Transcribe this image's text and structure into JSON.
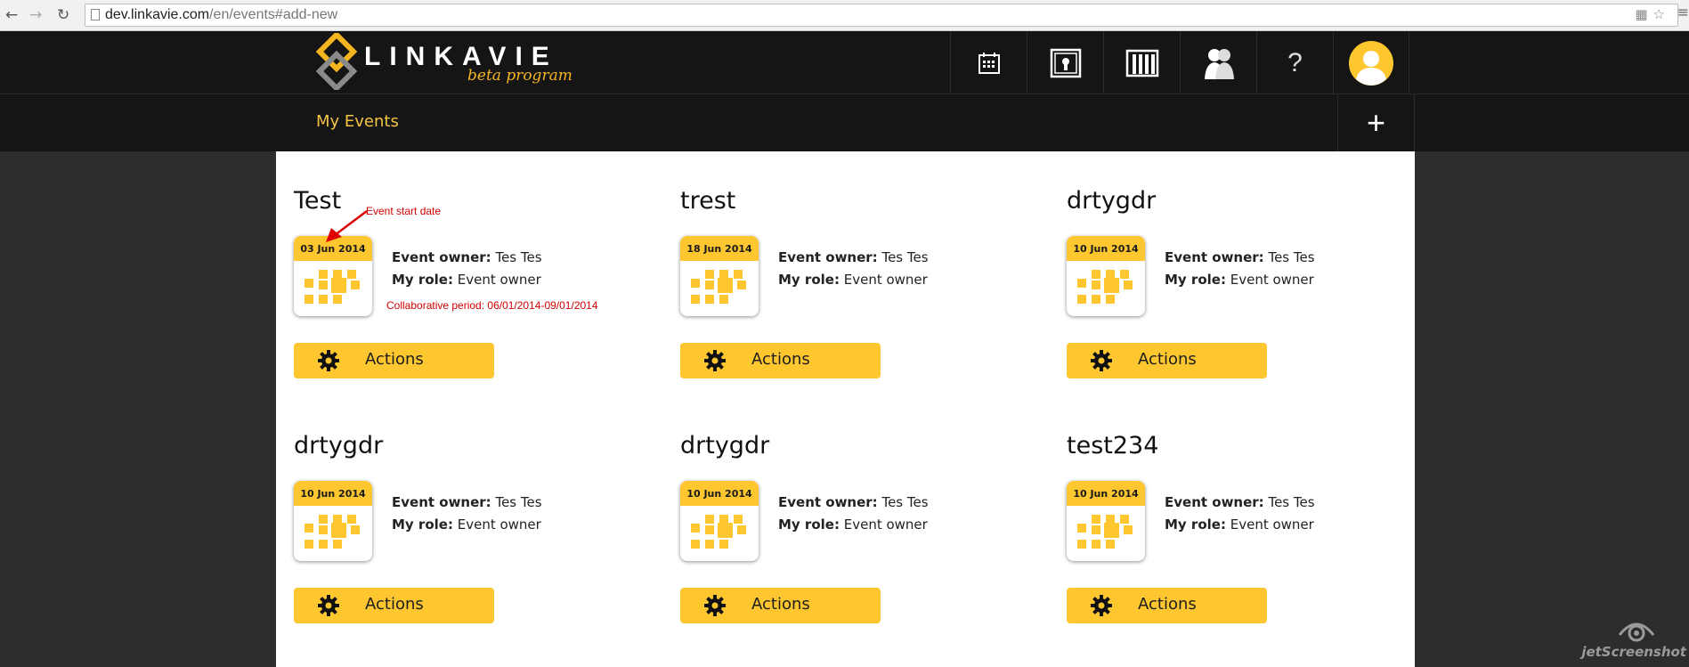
{
  "browser": {
    "url_host": "dev.linkavie.com",
    "url_path": "/en/events#add-new"
  },
  "header": {
    "logo_text": "LINKAVIE",
    "logo_tagline": "beta program",
    "nav_icons": [
      "calendar-icon",
      "gallery-lock-icon",
      "archive-icon",
      "people-icon",
      "help-icon"
    ],
    "help_label": "?",
    "brand_color": "#fec62f"
  },
  "subheader": {
    "title": "My Events",
    "add_label": "+"
  },
  "events": [
    {
      "title": "Test",
      "date": "03 Jun 2014",
      "owner_label": "Event owner:",
      "owner": "Tes Tes",
      "role_label": "My role:",
      "role": "Event owner",
      "action_label": "Actions"
    },
    {
      "title": "trest",
      "date": "18 Jun 2014",
      "owner_label": "Event owner:",
      "owner": "Tes Tes",
      "role_label": "My role:",
      "role": "Event owner",
      "action_label": "Actions"
    },
    {
      "title": "drtygdr",
      "date": "10 Jun 2014",
      "owner_label": "Event owner:",
      "owner": "Tes Tes",
      "role_label": "My role:",
      "role": "Event owner",
      "action_label": "Actions"
    },
    {
      "title": "drtygdr",
      "date": "10 Jun 2014",
      "owner_label": "Event owner:",
      "owner": "Tes Tes",
      "role_label": "My role:",
      "role": "Event owner",
      "action_label": "Actions"
    },
    {
      "title": "drtygdr",
      "date": "10 Jun 2014",
      "owner_label": "Event owner:",
      "owner": "Tes Tes",
      "role_label": "My role:",
      "role": "Event owner",
      "action_label": "Actions"
    },
    {
      "title": "test234",
      "date": "10 Jun 2014",
      "owner_label": "Event owner:",
      "owner": "Tes Tes",
      "role_label": "My role:",
      "role": "Event owner",
      "action_label": "Actions"
    }
  ],
  "annotations": {
    "start_date": "Event start date",
    "collab_period": "Collaborative period: 06/01/2014-09/01/2014",
    "color": "#d00000"
  },
  "watermark": {
    "text": "jetScreenshot"
  }
}
